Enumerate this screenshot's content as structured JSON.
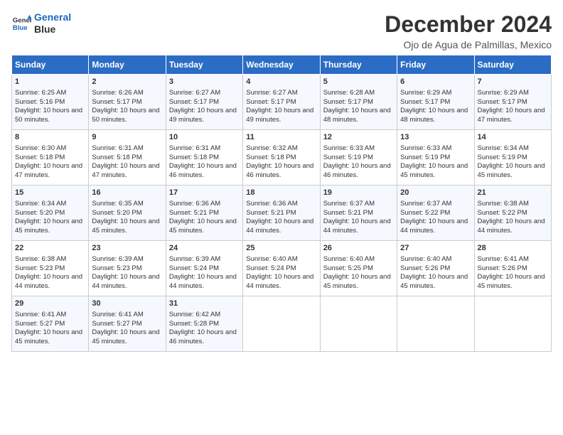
{
  "logo": {
    "line1": "General",
    "line2": "Blue"
  },
  "title": "December 2024",
  "location": "Ojo de Agua de Palmillas, Mexico",
  "days_of_week": [
    "Sunday",
    "Monday",
    "Tuesday",
    "Wednesday",
    "Thursday",
    "Friday",
    "Saturday"
  ],
  "weeks": [
    [
      {
        "day": "1",
        "sunrise": "6:25 AM",
        "sunset": "5:16 PM",
        "daylight": "10 hours and 50 minutes."
      },
      {
        "day": "2",
        "sunrise": "6:26 AM",
        "sunset": "5:17 PM",
        "daylight": "10 hours and 50 minutes."
      },
      {
        "day": "3",
        "sunrise": "6:27 AM",
        "sunset": "5:17 PM",
        "daylight": "10 hours and 49 minutes."
      },
      {
        "day": "4",
        "sunrise": "6:27 AM",
        "sunset": "5:17 PM",
        "daylight": "10 hours and 49 minutes."
      },
      {
        "day": "5",
        "sunrise": "6:28 AM",
        "sunset": "5:17 PM",
        "daylight": "10 hours and 48 minutes."
      },
      {
        "day": "6",
        "sunrise": "6:29 AM",
        "sunset": "5:17 PM",
        "daylight": "10 hours and 48 minutes."
      },
      {
        "day": "7",
        "sunrise": "6:29 AM",
        "sunset": "5:17 PM",
        "daylight": "10 hours and 47 minutes."
      }
    ],
    [
      {
        "day": "8",
        "sunrise": "6:30 AM",
        "sunset": "5:18 PM",
        "daylight": "10 hours and 47 minutes."
      },
      {
        "day": "9",
        "sunrise": "6:31 AM",
        "sunset": "5:18 PM",
        "daylight": "10 hours and 47 minutes."
      },
      {
        "day": "10",
        "sunrise": "6:31 AM",
        "sunset": "5:18 PM",
        "daylight": "10 hours and 46 minutes."
      },
      {
        "day": "11",
        "sunrise": "6:32 AM",
        "sunset": "5:18 PM",
        "daylight": "10 hours and 46 minutes."
      },
      {
        "day": "12",
        "sunrise": "6:33 AM",
        "sunset": "5:19 PM",
        "daylight": "10 hours and 46 minutes."
      },
      {
        "day": "13",
        "sunrise": "6:33 AM",
        "sunset": "5:19 PM",
        "daylight": "10 hours and 45 minutes."
      },
      {
        "day": "14",
        "sunrise": "6:34 AM",
        "sunset": "5:19 PM",
        "daylight": "10 hours and 45 minutes."
      }
    ],
    [
      {
        "day": "15",
        "sunrise": "6:34 AM",
        "sunset": "5:20 PM",
        "daylight": "10 hours and 45 minutes."
      },
      {
        "day": "16",
        "sunrise": "6:35 AM",
        "sunset": "5:20 PM",
        "daylight": "10 hours and 45 minutes."
      },
      {
        "day": "17",
        "sunrise": "6:36 AM",
        "sunset": "5:21 PM",
        "daylight": "10 hours and 45 minutes."
      },
      {
        "day": "18",
        "sunrise": "6:36 AM",
        "sunset": "5:21 PM",
        "daylight": "10 hours and 44 minutes."
      },
      {
        "day": "19",
        "sunrise": "6:37 AM",
        "sunset": "5:21 PM",
        "daylight": "10 hours and 44 minutes."
      },
      {
        "day": "20",
        "sunrise": "6:37 AM",
        "sunset": "5:22 PM",
        "daylight": "10 hours and 44 minutes."
      },
      {
        "day": "21",
        "sunrise": "6:38 AM",
        "sunset": "5:22 PM",
        "daylight": "10 hours and 44 minutes."
      }
    ],
    [
      {
        "day": "22",
        "sunrise": "6:38 AM",
        "sunset": "5:23 PM",
        "daylight": "10 hours and 44 minutes."
      },
      {
        "day": "23",
        "sunrise": "6:39 AM",
        "sunset": "5:23 PM",
        "daylight": "10 hours and 44 minutes."
      },
      {
        "day": "24",
        "sunrise": "6:39 AM",
        "sunset": "5:24 PM",
        "daylight": "10 hours and 44 minutes."
      },
      {
        "day": "25",
        "sunrise": "6:40 AM",
        "sunset": "5:24 PM",
        "daylight": "10 hours and 44 minutes."
      },
      {
        "day": "26",
        "sunrise": "6:40 AM",
        "sunset": "5:25 PM",
        "daylight": "10 hours and 45 minutes."
      },
      {
        "day": "27",
        "sunrise": "6:40 AM",
        "sunset": "5:26 PM",
        "daylight": "10 hours and 45 minutes."
      },
      {
        "day": "28",
        "sunrise": "6:41 AM",
        "sunset": "5:26 PM",
        "daylight": "10 hours and 45 minutes."
      }
    ],
    [
      {
        "day": "29",
        "sunrise": "6:41 AM",
        "sunset": "5:27 PM",
        "daylight": "10 hours and 45 minutes."
      },
      {
        "day": "30",
        "sunrise": "6:41 AM",
        "sunset": "5:27 PM",
        "daylight": "10 hours and 45 minutes."
      },
      {
        "day": "31",
        "sunrise": "6:42 AM",
        "sunset": "5:28 PM",
        "daylight": "10 hours and 46 minutes."
      },
      null,
      null,
      null,
      null
    ]
  ]
}
